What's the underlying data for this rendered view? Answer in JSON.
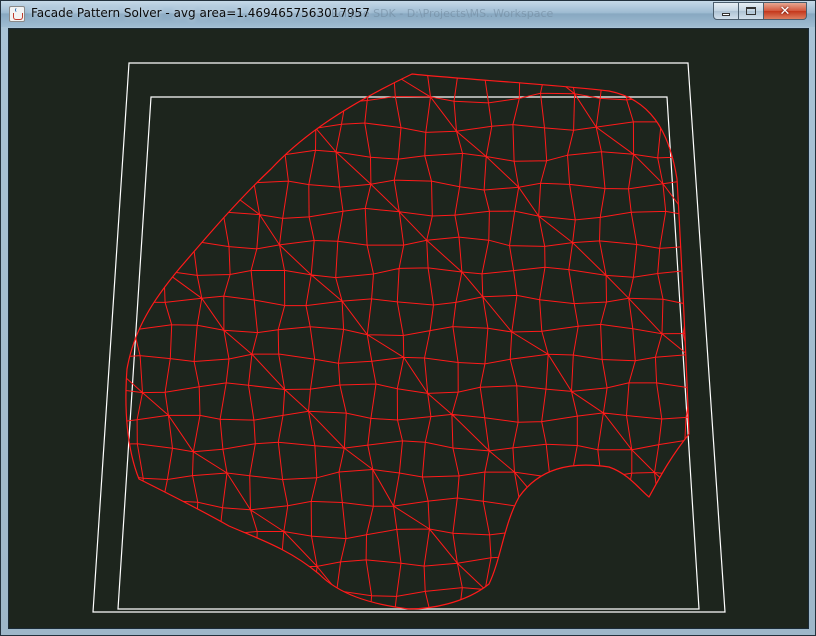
{
  "window": {
    "title": "Facade Pattern Solver - avg area=1.4694657563017957",
    "background_title": "Eclipse SDK - D:\\Projects\\MS..Workspace",
    "icon": "java-cup-icon",
    "controls": {
      "minimize_icon": "minimize-icon",
      "maximize_icon": "maximize-icon",
      "close_icon": "close-icon",
      "close_glyph": "✕"
    }
  },
  "canvas": {
    "background_color": "#1d251d",
    "frame_color": "#ffffff",
    "mesh_color": "#ff1a1a"
  }
}
